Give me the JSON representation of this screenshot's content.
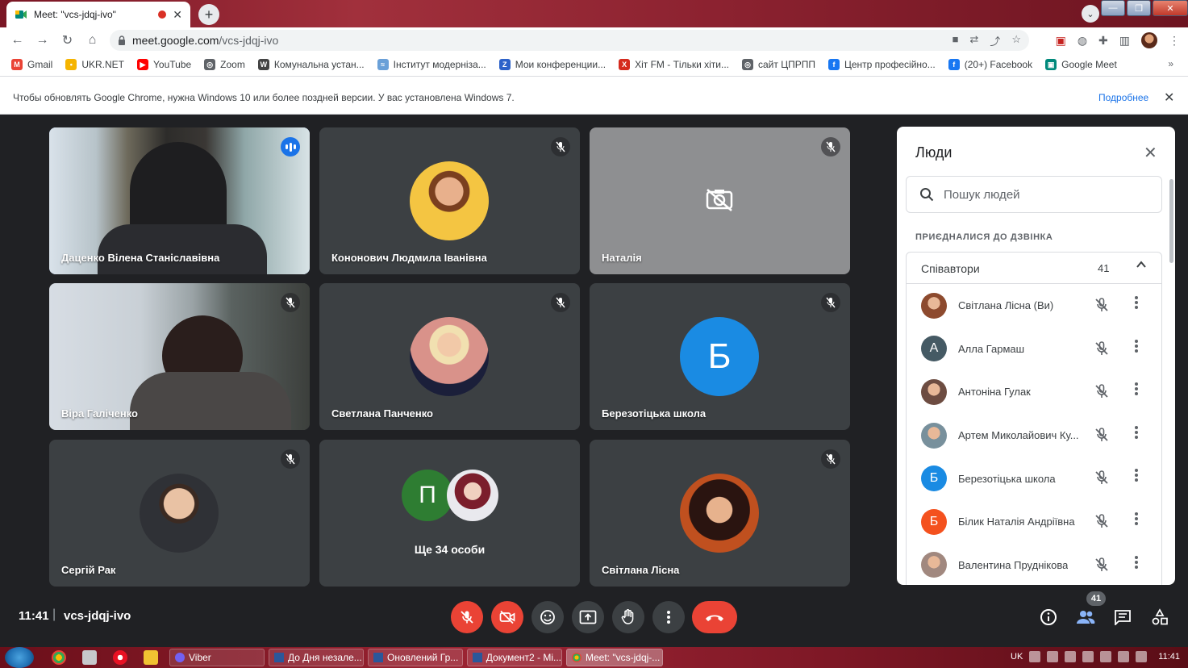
{
  "browser": {
    "tab_title": "Meet: \"vcs-jdqj-ivo\"",
    "tab_close": "✕",
    "new_tab": "+",
    "url_host": "meet.google.com",
    "url_path": "/vcs-jdqj-ivo",
    "bookmarks": [
      {
        "label": "Gmail",
        "color": "#ea4335",
        "glyph": "M"
      },
      {
        "label": "UKR.NET",
        "color": "#f5b400",
        "glyph": "•"
      },
      {
        "label": "YouTube",
        "color": "#ff0000",
        "glyph": "▶"
      },
      {
        "label": "Zoom",
        "color": "#5f6368",
        "glyph": "◎"
      },
      {
        "label": "Комунальна устан...",
        "color": "#444444",
        "glyph": "W"
      },
      {
        "label": "Інститут модерніза...",
        "color": "#6aa0d8",
        "glyph": "≈"
      },
      {
        "label": "Мои конференции...",
        "color": "#2d62c9",
        "glyph": "Z"
      },
      {
        "label": "Хіт FM - Тільки хіти...",
        "color": "#d52b1e",
        "glyph": "X"
      },
      {
        "label": "сайт ЦПРПП",
        "color": "#5f6368",
        "glyph": "◎"
      },
      {
        "label": "Центр професійно...",
        "color": "#1877f2",
        "glyph": "f"
      },
      {
        "label": "(20+) Facebook",
        "color": "#1877f2",
        "glyph": "f"
      },
      {
        "label": "Google Meet",
        "color": "#00897b",
        "glyph": "▣"
      }
    ],
    "bookmarks_more": "»",
    "infobar_text": "Чтобы обновлять Google Chrome, нужна Windows 10 или более поздней версии. У вас установлена Windows 7.",
    "infobar_link": "Подробнее",
    "infobar_close": "✕"
  },
  "tiles": [
    {
      "name": "Даценко Вілена Станіславівна",
      "state": "speaking"
    },
    {
      "name": "Кононович Людмила Іванівна",
      "state": "muted"
    },
    {
      "name": "Наталія",
      "state": "muted",
      "camera": "off"
    },
    {
      "name": "Віра Галіченко",
      "state": "muted"
    },
    {
      "name": "Светлана Панченко",
      "state": "muted"
    },
    {
      "name": "Березотіцька школа",
      "state": "muted",
      "initial": "Б",
      "color": "#1a8be3"
    },
    {
      "name": "Сергій Рак",
      "state": "muted"
    },
    {
      "name": "Ще 34 особи",
      "state": "group",
      "initial": "П",
      "color": "#2e7d32"
    },
    {
      "name": "Світлана Лісна",
      "state": "muted"
    }
  ],
  "people_panel": {
    "title": "Люди",
    "close": "✕",
    "search_placeholder": "Пошук людей",
    "section": "ПРИЄДНАЛИСЯ ДО ДЗВІНКА",
    "group_label": "Співавтори",
    "group_count": "41",
    "people": [
      {
        "name": "Світлана Лісна (Ви)",
        "initial": "",
        "color": "#8d4a2e"
      },
      {
        "name": "Алла Гармаш",
        "initial": "А",
        "color": "#455a64"
      },
      {
        "name": "Антоніна Гулак",
        "initial": "",
        "color": "#6d4c41"
      },
      {
        "name": "Артем Миколайович Ку...",
        "initial": "",
        "color": "#78909c"
      },
      {
        "name": "Березотіцька школа",
        "initial": "Б",
        "color": "#1a8be3"
      },
      {
        "name": "Білик Наталія Андріївна",
        "initial": "Б",
        "color": "#f4511e"
      },
      {
        "name": "Валентина Пруднікова",
        "initial": "",
        "color": "#a1887f"
      }
    ]
  },
  "controls": {
    "time": "11:41",
    "separator": "|",
    "meeting_code": "vcs-jdqj-ivo",
    "people_badge": "41"
  },
  "taskbar": {
    "items": [
      "Viber",
      "До Дня незале...",
      "Оновлений Гр...",
      "Документ2 - Mi...",
      "Meet: \"vcs-jdqj-..."
    ],
    "lang": "UK",
    "clock": "11:41"
  }
}
